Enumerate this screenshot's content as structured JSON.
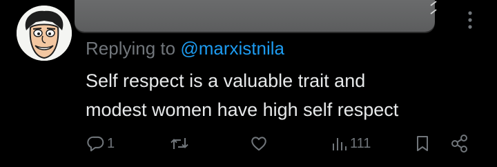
{
  "reply": {
    "prefix": "Replying to",
    "handle": "@marxistnila"
  },
  "tweet": {
    "lines": [
      "Self respect is a valuable trait and",
      "modest women have high self respect"
    ]
  },
  "actions": {
    "reply_count": "1",
    "retweet_count": "",
    "like_count": "",
    "views_count": "111"
  },
  "colors": {
    "background": "#000000",
    "text": "#e7e9ea",
    "muted": "#71767b",
    "link": "#1d9bf0"
  },
  "icons": [
    "avatar",
    "more-icon",
    "reply-icon",
    "retweet-icon",
    "like-icon",
    "views-icon",
    "bookmark-icon",
    "share-icon"
  ]
}
